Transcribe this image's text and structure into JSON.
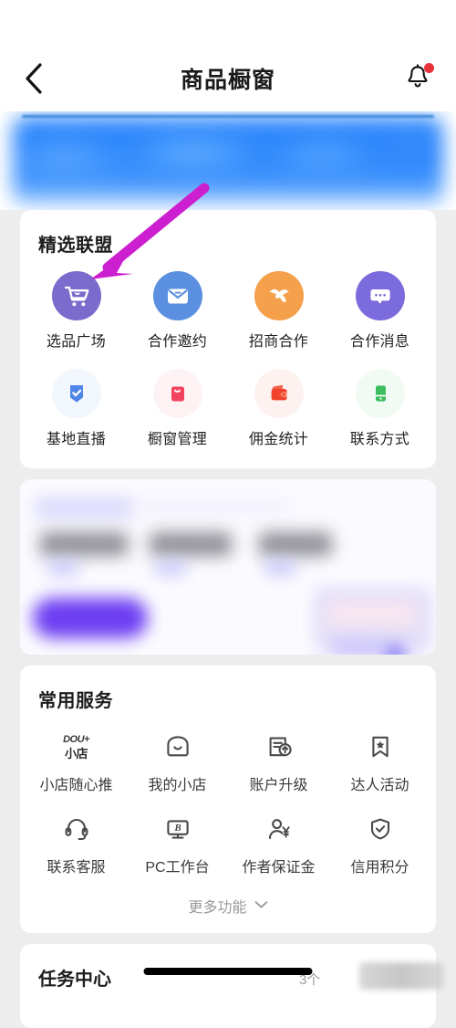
{
  "header": {
    "title": "商品橱窗",
    "back_icon": "chevron-left-icon",
    "bell_icon": "bell-icon",
    "has_badge": true
  },
  "banner": {
    "description": "blurred blue promotional banner",
    "color": "#2f88fd"
  },
  "alliance": {
    "title": "精选联盟",
    "row1": [
      {
        "label": "选品广场",
        "icon": "shopping-cart-icon",
        "bg": "#7b6bcc",
        "fg": "#ffffff"
      },
      {
        "label": "合作邀约",
        "icon": "envelope-icon",
        "bg": "#5b8fe0",
        "fg": "#ffffff"
      },
      {
        "label": "招商合作",
        "icon": "handshake-icon",
        "bg": "#f5a04a",
        "fg": "#ffffff"
      },
      {
        "label": "合作消息",
        "icon": "chat-bubble-icon",
        "bg": "#7b6bdc",
        "fg": "#ffffff"
      }
    ],
    "row2": [
      {
        "label": "基地直播",
        "icon": "shield-check-icon",
        "bg": "#f2f6fd",
        "fg": "#4f86e8"
      },
      {
        "label": "橱窗管理",
        "icon": "shopping-bag-icon",
        "bg": "#fdf2f4",
        "fg": "#f2435f"
      },
      {
        "label": "佣金统计",
        "icon": "wallet-icon",
        "bg": "#fdf2f0",
        "fg": "#f0432c"
      },
      {
        "label": "联系方式",
        "icon": "phone-device-icon",
        "bg": "#f1fbf3",
        "fg": "#3dbd5e"
      }
    ]
  },
  "promo": {
    "description": "blurred purple statistics promo card"
  },
  "services": {
    "title": "常用服务",
    "row1": [
      {
        "label": "小店随心推",
        "icon": "douplus-shop-icon",
        "logo_top": "DOU+",
        "logo_bottom": "小店"
      },
      {
        "label": "我的小店",
        "icon": "storefront-icon"
      },
      {
        "label": "账户升级",
        "icon": "document-upgrade-icon"
      },
      {
        "label": "达人活动",
        "icon": "bookmark-star-icon"
      }
    ],
    "row2": [
      {
        "label": "联系客服",
        "icon": "headset-icon"
      },
      {
        "label": "PC工作台",
        "icon": "monitor-b-icon"
      },
      {
        "label": "作者保证金",
        "icon": "person-yuan-icon"
      },
      {
        "label": "信用积分",
        "icon": "shield-check-outline-icon"
      }
    ],
    "more_label": "更多功能",
    "more_icon": "chevron-down-icon"
  },
  "task_center": {
    "title": "任务中心",
    "count": "3个"
  },
  "annotation": {
    "arrow_color": "#cc1fd0",
    "points_to": "选品广场"
  }
}
